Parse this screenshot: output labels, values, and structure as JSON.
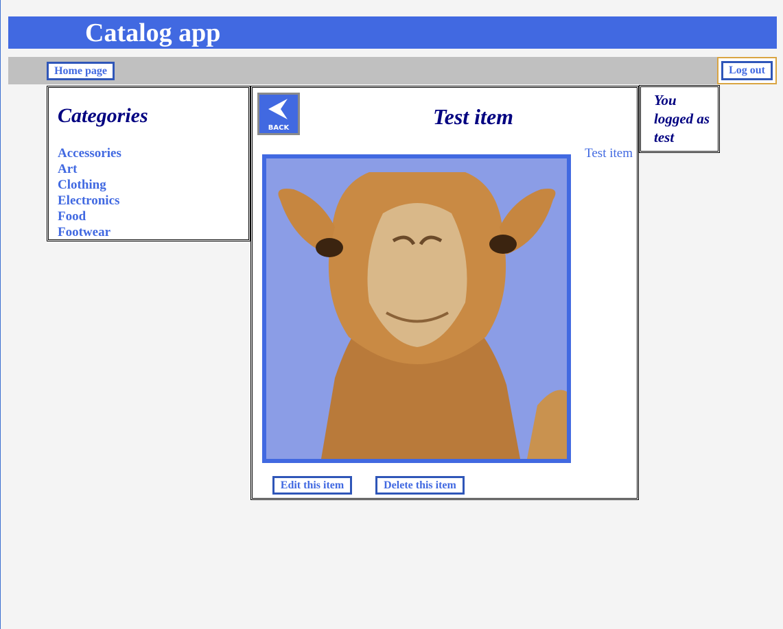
{
  "header": {
    "title": "Catalog app"
  },
  "nav": {
    "home_label": "Home page",
    "logout_label": "Log out"
  },
  "categories": {
    "heading": "Categories",
    "items": [
      "Accessories",
      "Art",
      "Clothing",
      "Electronics",
      "Food",
      "Footwear"
    ]
  },
  "item": {
    "back_label": "BACK",
    "title": "Test item",
    "description": "Test item",
    "image_icon": "camel-photo",
    "edit_label": "Edit this item",
    "delete_label": "Delete this item"
  },
  "user": {
    "message": "You logged as test"
  },
  "colors": {
    "header_bg": "#4169e1",
    "nav_bg": "#c0c0c0",
    "link": "#4169e1",
    "heading": "#000080",
    "page_bg": "#f4f4f4"
  }
}
